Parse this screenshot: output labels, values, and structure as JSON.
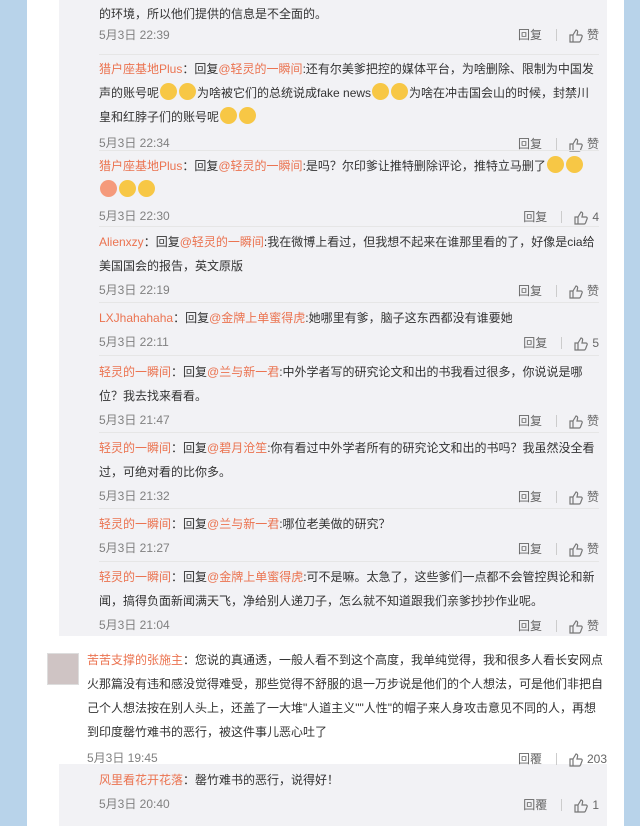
{
  "comments": [
    {
      "user": "",
      "prefix": "",
      "text": "的环境，所以他们提供的信息是不全面的。",
      "text2": "",
      "time": "5月3日 22:39",
      "reply": "回复",
      "like": "赞"
    },
    {
      "user": "猎户座基地Plus",
      "prefix": "：回复",
      "mention": "@轻灵的一瞬间",
      "text": ":还有尔美爹把控的媒体平台，为啥删除、限制为中国发",
      "line2a": "声的账号呢",
      "line2b": "为啥被它们的总统说成fake news",
      "line2c": "为啥在冲击国会山的时候，封禁川",
      "line3": "皇和红脖子们的账号呢",
      "time": "5月3日 22:34",
      "reply": "回复",
      "like": "赞"
    },
    {
      "user": "猎户座基地Plus",
      "prefix": "：回复",
      "mention": "@轻灵的一瞬间",
      "text": ":是吗？尔印爹让推特删除评论，推特立马删了",
      "time": "5月3日 22:30",
      "reply": "回复",
      "like": "4"
    },
    {
      "user": "Alienxzy",
      "prefix": "：回复",
      "mention": "@轻灵的一瞬间",
      "text": ":我在微博上看过，但我想不起来在谁那里看的了，好像是cia给",
      "line2": "美国国会的报告，英文原版",
      "time": "5月3日 22:19",
      "reply": "回复",
      "like": "赞"
    },
    {
      "user": "LXJhahahaha",
      "prefix": "：回复",
      "mention": "@金牌上单蜜得虎",
      "text": ":她哪里有爹，脑子这东西都没有谁要她",
      "time": "5月3日 22:11",
      "reply": "回复",
      "like": "5"
    },
    {
      "user": "轻灵的一瞬间",
      "prefix": "：回复",
      "mention": "@兰与新一君",
      "text": ":中外学者写的研究论文和出的书我看过很多，你说说是哪",
      "line2": "位？我去找来看看。",
      "time": "5月3日 21:47",
      "reply": "回复",
      "like": "赞"
    },
    {
      "user": "轻灵的一瞬间",
      "prefix": "：回复",
      "mention": "@碧月沧笙",
      "text": ":你有看过中外学者所有的研究论文和出的书吗？我虽然没全看",
      "line2": "过，可绝对看的比你多。",
      "time": "5月3日 21:32",
      "reply": "回复",
      "like": "赞"
    },
    {
      "user": "轻灵的一瞬间",
      "prefix": "：回复",
      "mention": "@兰与新一君",
      "text": ":哪位老美做的研究？",
      "time": "5月3日 21:27",
      "reply": "回复",
      "like": "赞"
    },
    {
      "user": "轻灵的一瞬间",
      "prefix": "：回复",
      "mention": "@金牌上单蜜得虎",
      "text": ":可不是嘛。太急了，这些爹们一点都不会管控舆论和新",
      "line2": "闻，搞得负面新闻满天飞，净给别人递刀子，怎么就不知道跟我们亲爹抄抄作业呢。",
      "time": "5月3日 21:04",
      "reply": "回复",
      "like": "赞"
    }
  ],
  "main": {
    "user": "苦苦支撑的张施主",
    "line1": "：您说的真通透，一般人看不到这个高度，我单纯觉得，我和很多人看长安网点",
    "line2": "火那篇没有违和感没觉得难受，那些觉得不舒服的退一万步说是他们的个人想法，可是他们非把自",
    "line3": "己个人想法按在别人头上，还盖了一大堆\"人道主义\"\"人性\"的帽子来人身攻击意见不同的人，再想",
    "line4": "到印度罄竹难书的恶行，被这件事儿恶心吐了",
    "time": "5月3日 19:45",
    "reply": "回覆",
    "like": "203"
  },
  "sub": {
    "user": "风里看花开花落",
    "text": "：罄竹难书的恶行，说得好！",
    "time": "5月3日 20:40",
    "reply": "回覆",
    "like": "1"
  }
}
